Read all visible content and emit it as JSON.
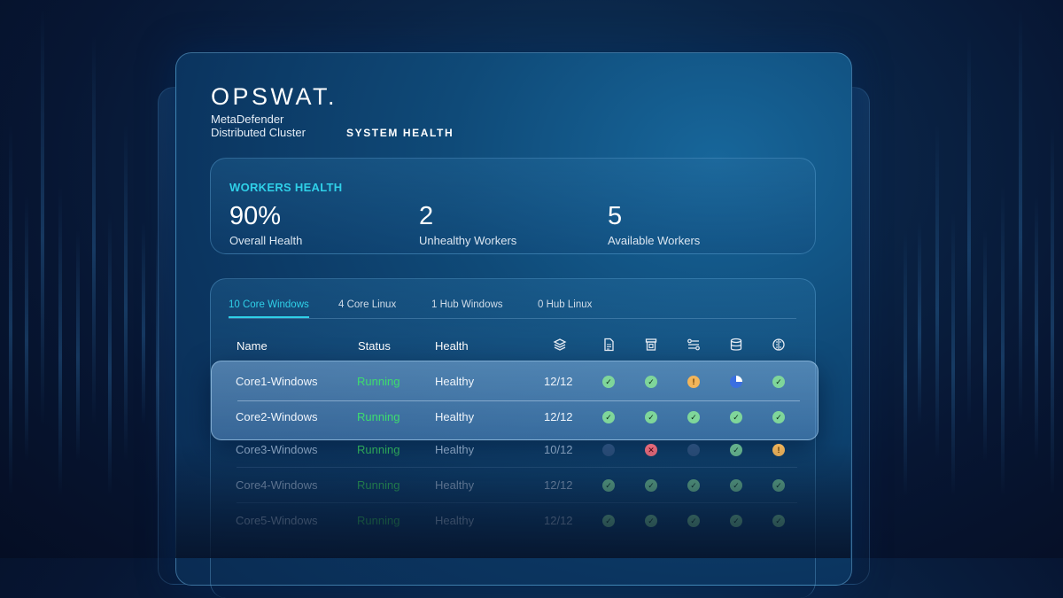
{
  "brand": {
    "logo": "OPSWAT.",
    "product_line1": "MetaDefender",
    "product_line2": "Distributed Cluster",
    "section": "SYSTEM HEALTH"
  },
  "workers_health": {
    "title": "WORKERS HEALTH",
    "metrics": [
      {
        "value": "90%",
        "label": "Overall Health"
      },
      {
        "value": "2",
        "label": "Unhealthy Workers"
      },
      {
        "value": "5",
        "label": "Available Workers"
      }
    ]
  },
  "tabs": [
    {
      "label": "10 Core Windows",
      "active": true
    },
    {
      "label": "4 Core Linux",
      "active": false
    },
    {
      "label": "1 Hub Windows",
      "active": false
    },
    {
      "label": "0 Hub Linux",
      "active": false
    }
  ],
  "table": {
    "columns": {
      "name": "Name",
      "status": "Status",
      "health": "Health"
    },
    "icon_columns": [
      "layers-icon",
      "file-scan-icon",
      "archive-icon",
      "workflow-icon",
      "database-icon",
      "engine-icon"
    ],
    "rows": [
      {
        "name": "Core1-Windows",
        "status": "Running",
        "health": "Healthy",
        "count": "12/12",
        "checks": [
          "ok",
          "ok",
          "warn",
          "pie",
          "ok"
        ]
      },
      {
        "name": "Core2-Windows",
        "status": "Running",
        "health": "Healthy",
        "count": "12/12",
        "checks": [
          "ok",
          "ok",
          "ok",
          "ok",
          "ok"
        ]
      },
      {
        "name": "Core3-Windows",
        "status": "Running",
        "health": "Healthy",
        "count": "10/12",
        "checks": [
          "dim",
          "err",
          "dim",
          "ok",
          "warn"
        ]
      },
      {
        "name": "Core4-Windows",
        "status": "Running",
        "health": "Healthy",
        "count": "12/12",
        "checks": [
          "ok",
          "ok",
          "ok",
          "ok",
          "ok"
        ]
      },
      {
        "name": "Core5-Windows",
        "status": "Running",
        "health": "Healthy",
        "count": "12/12",
        "checks": [
          "ok",
          "ok",
          "ok",
          "ok",
          "ok"
        ]
      }
    ]
  },
  "colors": {
    "accent": "#2fd0e8",
    "running": "#3ddc6e",
    "ok": "#7fd69a",
    "warn": "#f2b55a",
    "error": "#e86a7a"
  }
}
